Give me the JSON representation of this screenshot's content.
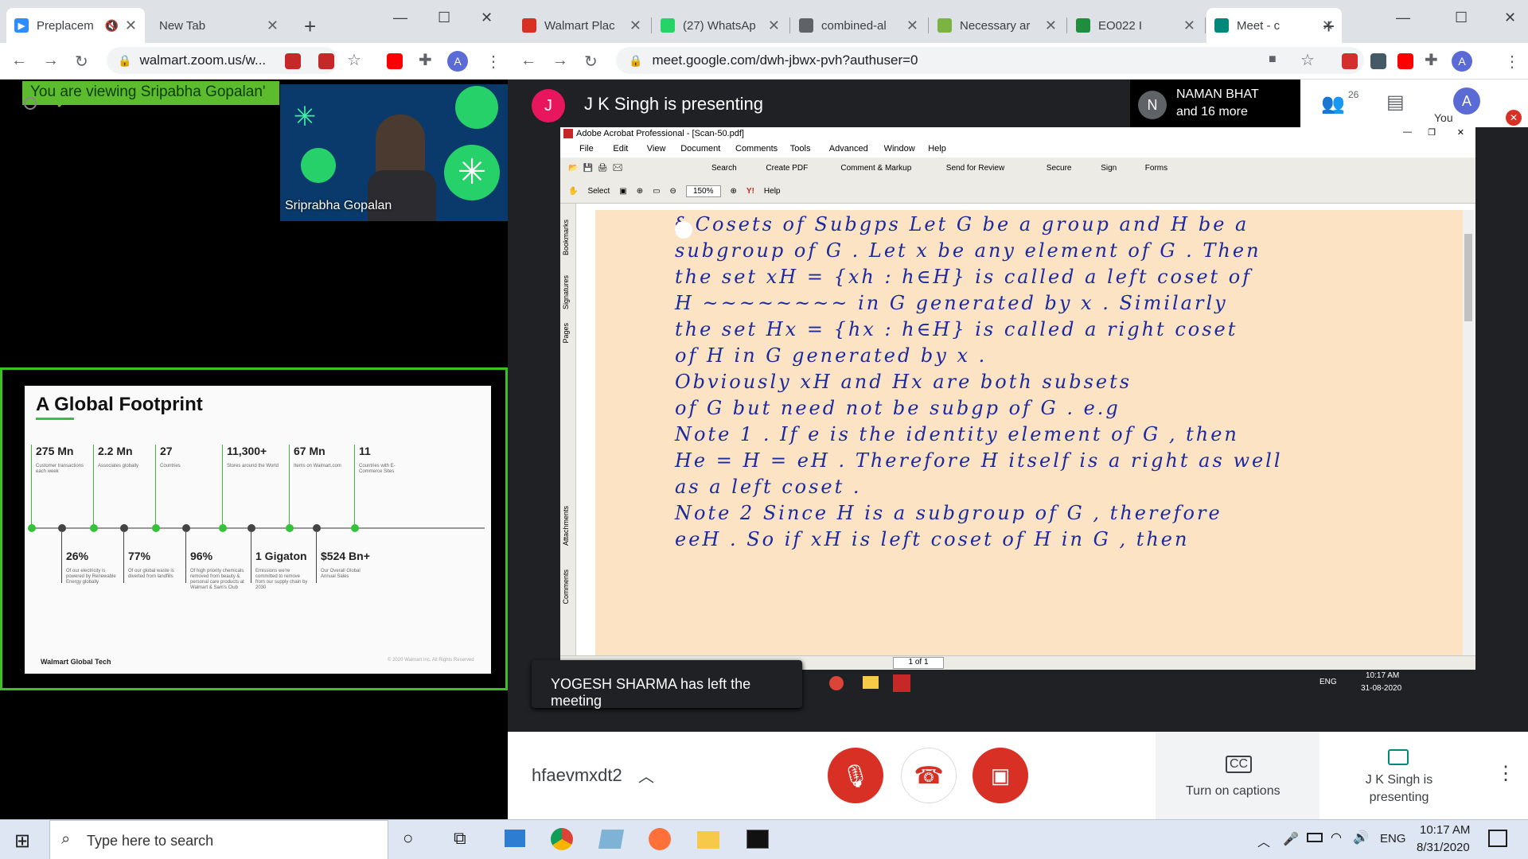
{
  "left_browser": {
    "tabs": [
      {
        "title": "Preplacem",
        "favicon": "zoom-icon"
      },
      {
        "title": "New Tab",
        "favicon": ""
      }
    ],
    "url": "walmart.zoom.us/w..."
  },
  "zoom": {
    "banner": "You are viewing Sripabha Gopalan'",
    "participant_name": "Sriprabha Gopalan",
    "slide": {
      "title": "A Global Footprint",
      "top_stats": [
        {
          "value": "275 Mn",
          "caption": "Customer transactions each week"
        },
        {
          "value": "2.2 Mn",
          "caption": "Associates globally"
        },
        {
          "value": "27",
          "caption": "Countries"
        },
        {
          "value": "11,300+",
          "caption": "Stores around the World"
        },
        {
          "value": "67 Mn",
          "caption": "Items on Walmart.com"
        },
        {
          "value": "11",
          "caption": "Countries with E-Commerce Sites"
        }
      ],
      "bottom_stats": [
        {
          "value": "26%",
          "caption": "Of our electricity is powered by Renewable Energy globally"
        },
        {
          "value": "77%",
          "caption": "Of our global waste is diverted from landfills"
        },
        {
          "value": "96%",
          "caption": "Of high priority chemicals removed from beauty & personal care products at Walmart & Sam's Club"
        },
        {
          "value": "1 Gigaton",
          "caption": "Emissions we're committed to remove from our supply chain by 2030"
        },
        {
          "value": "$524 Bn+",
          "caption": "Our Overall Global Annual Sales"
        }
      ],
      "footer_brand": "Walmart Global Tech",
      "copyright": "© 2020 Walmart Inc. All Rights Reserved"
    }
  },
  "right_browser": {
    "tabs": [
      {
        "title": "Walmart Plac",
        "favicon": "gmail-icon",
        "color": "#d93025"
      },
      {
        "title": "(27) WhatsAp",
        "favicon": "whatsapp-icon",
        "color": "#25d366"
      },
      {
        "title": "combined-al",
        "favicon": "globe-icon",
        "color": "#5f6368"
      },
      {
        "title": "Necessary ar",
        "favicon": "leaf-icon",
        "color": "#7cb342"
      },
      {
        "title": "EO022 I",
        "favicon": "classroom-icon",
        "color": "#1e8e3e"
      },
      {
        "title": "Meet - c",
        "favicon": "meet-icon",
        "color": "#00897b"
      }
    ],
    "url": "meet.google.com/dwh-jbwx-pvh?authuser=0"
  },
  "meet": {
    "presenter_initial": "J",
    "presenting_text": "J K Singh is presenting",
    "other_initial": "N",
    "other_name": "NAMAN BHAT",
    "other_more": "and 16 more",
    "participant_count": "26",
    "you_initial": "A",
    "you_label": "You",
    "toast": "YOGESH SHARMA has left the meeting",
    "meeting_code": "hfaevmxdt2",
    "captions_label": "Turn on captions",
    "present_label": "J K Singh is presenting"
  },
  "acrobat": {
    "title": "Adobe Acrobat Professional - [Scan-50.pdf]",
    "menus": [
      "File",
      "Edit",
      "View",
      "Document",
      "Comments",
      "Tools",
      "Advanced",
      "Window",
      "Help"
    ],
    "toolbar": [
      "Search",
      "Create PDF",
      "Comment & Markup",
      "Send for Review",
      "Secure",
      "Sign",
      "Forms"
    ],
    "select_label": "Select",
    "zoom": "150%",
    "help": "Help",
    "page_box": "1 of 1",
    "side_tabs": [
      "Bookmarks",
      "Signatures",
      "Pages",
      "Attachments",
      "Comments"
    ],
    "notes": [
      "§ Cosets of Subgps   Let G be a group and H be a",
      "subgroup of G . Let x be any element of G . Then",
      "the set  xH = {xh : h∈H} is called a left coset of",
      "H  ~~~~~~~~  in G generated by x . Similarly",
      "the set  Hx = {hx : h∈H} is called a right coset",
      "of H in G generated by x .",
      "      Obviously  xH  and  Hx  are both subsets",
      "of G but need not be subgp of G . e.g",
      "Note 1 .  If e is the identity element of G , then",
      "He = H = eH . Therefore H itself is a right as well",
      "as  a left coset .",
      "Note 2    Since  H is a subgroup of G , therefore",
      "eeH . So if xH is left coset of H in G , then"
    ]
  },
  "inner_taskbar": {
    "lang": "ENG",
    "time": "10:17 AM",
    "date": "31-08-2020"
  },
  "taskbar": {
    "search_placeholder": "Type here to search",
    "lang": "ENG",
    "time": "10:17 AM",
    "date": "8/31/2020"
  }
}
